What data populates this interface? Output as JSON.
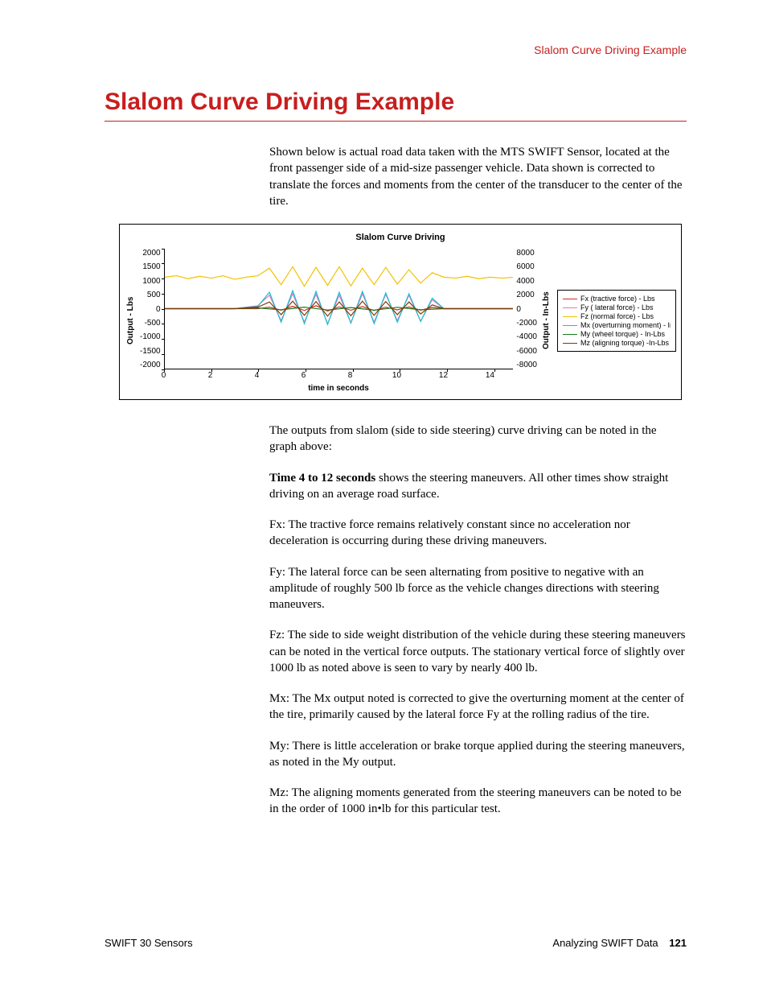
{
  "running_head": "Slalom Curve Driving Example",
  "title": "Slalom Curve Driving Example",
  "intro": "Shown below is actual road data taken with the MTS SWIFT Sensor, located at the front passenger side of a mid-size passenger vehicle. Data shown is corrected to translate the forces and moments from the center of the transducer to the center of the tire.",
  "para_after_chart": "The outputs from slalom (side to side steering) curve driving can be noted in the graph above:",
  "time_bold": "Time 4 to 12 seconds",
  "time_rest": " shows the steering maneuvers. All other times show straight driving on an average road surface.",
  "fx": "Fx: The tractive force remains relatively constant since no acceleration nor deceleration is occurring during these driving maneuvers.",
  "fy": "Fy: The lateral force can be seen alternating from positive to negative with an amplitude of roughly 500 lb force as the vehicle changes directions with steering maneuvers.",
  "fz": "Fz: The side to side weight distribution of the vehicle during these steering maneuvers can be noted in the vertical force outputs. The stationary vertical force of slightly over 1000 lb as noted above is seen to vary by nearly 400 lb.",
  "mx": "Mx: The Mx output noted is corrected to give the overturning moment at the center of the tire, primarily caused by the lateral force Fy at the rolling radius of the tire.",
  "my": "My: There is little acceleration or brake torque applied during the steering maneuvers, as noted in the My output.",
  "mz": "Mz: The aligning moments generated from the steering maneuvers can be noted to be in the order of 1000 in•lb for this particular test.",
  "footer_left": "SWIFT 30 Sensors",
  "footer_right_text": "Analyzing SWIFT Data",
  "footer_page": "121",
  "chart_data": {
    "type": "line",
    "title": "Slalom Curve Driving",
    "xlabel": "time in seconds",
    "ylabel_left": "Output - Lbs",
    "ylabel_right": "Output - In-Lbs",
    "xticks": [
      "0",
      "2",
      "4",
      "6",
      "8",
      "10",
      "12",
      "14"
    ],
    "yticks_left": [
      "2000",
      "1500",
      "1000",
      "500",
      "0",
      "-500",
      "-1000",
      "-1500",
      "-2000"
    ],
    "yticks_right": [
      "8000",
      "6000",
      "4000",
      "2000",
      "0",
      "-2000",
      "-4000",
      "-6000",
      "-8000"
    ],
    "xlim": [
      0,
      15
    ],
    "ylim_left": [
      -2000,
      2000
    ],
    "ylim_right": [
      -8000,
      8000
    ],
    "legend": [
      {
        "name": "Fx (tractive force) - Lbs",
        "color": "#d62728"
      },
      {
        "name": "Fy ( lateral force) - Lbs",
        "color": "#e377c2"
      },
      {
        "name": "Fz (normal force) - Lbs",
        "color": "#f2c200"
      },
      {
        "name": "Mx (overturning moment) - In-",
        "color": "#17becf"
      },
      {
        "name": "My (wheel torque) - In-Lbs",
        "color": "#1a7a1a"
      },
      {
        "name": "Mz (aligning torque) -In-Lbs",
        "color": "#7a3b00"
      }
    ],
    "series": [
      {
        "name": "Fx",
        "axis": "left",
        "color": "#d62728",
        "x": [
          0,
          1,
          2,
          3,
          4,
          4.5,
          5,
          5.5,
          6,
          6.5,
          7,
          7.5,
          8,
          8.5,
          9,
          9.5,
          10,
          10.5,
          11,
          11.5,
          12,
          13,
          14,
          15
        ],
        "y": [
          0,
          0,
          0,
          0,
          0,
          50,
          -50,
          80,
          -60,
          100,
          -80,
          60,
          -50,
          70,
          -60,
          50,
          -40,
          60,
          -50,
          40,
          0,
          0,
          0,
          0
        ]
      },
      {
        "name": "Fy",
        "axis": "left",
        "color": "#e377c2",
        "x": [
          0,
          1,
          2,
          3,
          4,
          4.5,
          5,
          5.5,
          6,
          6.5,
          7,
          7.5,
          8,
          8.5,
          9,
          9.5,
          10,
          10.5,
          11,
          11.5,
          12,
          13,
          14,
          15
        ],
        "y": [
          0,
          0,
          0,
          0,
          100,
          450,
          -400,
          500,
          -450,
          480,
          -500,
          450,
          -480,
          500,
          -450,
          480,
          -400,
          450,
          -420,
          300,
          0,
          0,
          0,
          0
        ]
      },
      {
        "name": "Fz",
        "axis": "left",
        "color": "#f2c200",
        "x": [
          0,
          0.5,
          1,
          1.5,
          2,
          2.5,
          3,
          3.5,
          4,
          4.5,
          5,
          5.5,
          6,
          6.5,
          7,
          7.5,
          8,
          8.5,
          9,
          9.5,
          10,
          10.5,
          11,
          11.5,
          12,
          12.5,
          13,
          13.5,
          14,
          14.5,
          15
        ],
        "y": [
          1050,
          1100,
          1000,
          1080,
          1020,
          1100,
          980,
          1050,
          1100,
          1350,
          800,
          1400,
          750,
          1380,
          780,
          1400,
          760,
          1350,
          800,
          1380,
          820,
          1300,
          850,
          1200,
          1050,
          1020,
          1080,
          1000,
          1050,
          1020,
          1050
        ]
      },
      {
        "name": "Mx",
        "axis": "right",
        "color": "#17becf",
        "x": [
          0,
          1,
          2,
          3,
          4,
          4.5,
          5,
          5.5,
          6,
          6.5,
          7,
          7.5,
          8,
          8.5,
          9,
          9.5,
          10,
          10.5,
          11,
          11.5,
          12,
          13,
          14,
          15
        ],
        "y": [
          0,
          0,
          0,
          0,
          300,
          2200,
          -1800,
          2400,
          -2000,
          2300,
          -2100,
          2200,
          -1900,
          2300,
          -2000,
          2100,
          -1800,
          2000,
          -1700,
          1400,
          0,
          0,
          0,
          0
        ]
      },
      {
        "name": "My",
        "axis": "right",
        "color": "#1a7a1a",
        "x": [
          0,
          1,
          2,
          3,
          4,
          5,
          6,
          7,
          8,
          9,
          10,
          11,
          12,
          13,
          14,
          15
        ],
        "y": [
          0,
          0,
          0,
          0,
          100,
          -150,
          200,
          -180,
          150,
          -200,
          180,
          -150,
          0,
          0,
          0,
          0
        ]
      },
      {
        "name": "Mz",
        "axis": "right",
        "color": "#7a3b00",
        "x": [
          0,
          1,
          2,
          3,
          4,
          4.5,
          5,
          5.5,
          6,
          6.5,
          7,
          7.5,
          8,
          8.5,
          9,
          9.5,
          10,
          10.5,
          11,
          11.5,
          12,
          13,
          14,
          15
        ],
        "y": [
          0,
          0,
          0,
          0,
          200,
          900,
          -800,
          1000,
          -900,
          950,
          -1000,
          900,
          -950,
          1000,
          -900,
          950,
          -800,
          900,
          -700,
          500,
          0,
          0,
          0,
          0
        ]
      }
    ]
  }
}
